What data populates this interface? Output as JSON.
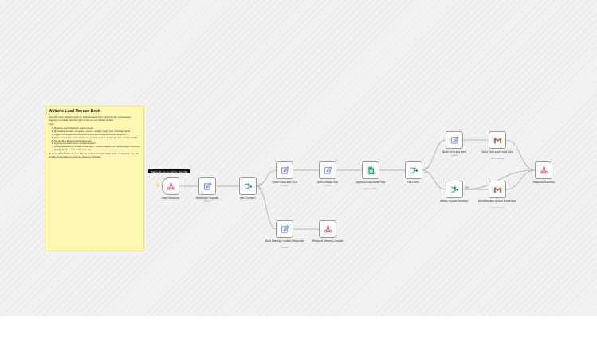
{
  "sticky_note": {
    "title": "Website Lead Rescue Desk",
    "intro": "Use this when website leads go stale because form payloads are inconsistent, urgency is unclear, and the right person is not notified quickly.",
    "flow_heading": "Flow",
    "steps": [
      "Receive a website/form lead payload.",
      "Normalize contact, company, source, budget, page, and message fields.",
      "Reject incomplete submissions with a structured webhook response.",
      "Score intent from pricing/demo/urgent/integration language plus contact quality.",
      "Set an SLA bucket and dedupe key.",
      "Append an audit row to Google Sheets.",
      "Route hot leads to a sales Gmail alert; medium leads to a review queue; and low-priority leads to a normal response."
    ],
    "footer": "Replace placeholder Google Sheets and Gmail credentials before production use. No private credentials or customer data are included."
  },
  "tooltip": "Waiting for you to call the Test URL",
  "nodes": [
    {
      "id": "lead-webhook",
      "label": "Lead Webhook",
      "sub": "",
      "icon": "webhook-icon",
      "color": "#ee4a7a",
      "trigger": true
    },
    {
      "id": "normalize-payload",
      "label": "Normalize Payload",
      "sub": "manual",
      "icon": "pencil-icon",
      "color": "#6a82e0"
    },
    {
      "id": "has-contact",
      "label": "Has Contact?",
      "sub": "",
      "icon": "if-branch-icon",
      "color": "#26948a"
    },
    {
      "id": "score-lead-sla",
      "label": "Score Lead and SLA",
      "sub": "manual",
      "icon": "pencil-icon",
      "color": "#6a82e0"
    },
    {
      "id": "build-unique-key",
      "label": "Build Unique Key",
      "sub": "manual",
      "icon": "pencil-icon",
      "color": "#6a82e0"
    },
    {
      "id": "append-audit-row",
      "label": "Append Lead Audit Row",
      "sub": "append: sheet",
      "icon": "google-sheets-icon",
      "color": "#1fa463"
    },
    {
      "id": "hot-lead",
      "label": "Hot Lead?",
      "sub": "",
      "icon": "if-branch-icon",
      "color": "#26948a"
    },
    {
      "id": "build-hot-alert",
      "label": "Build Hot Lead Alert",
      "sub": "manual",
      "icon": "pencil-icon",
      "color": "#6a82e0"
    },
    {
      "id": "send-hot-email",
      "label": "Send Hot Lead Email Alert",
      "sub": "send: message",
      "icon": "gmail-icon",
      "color": "#ea4335"
    },
    {
      "id": "needs-review",
      "label": "Needs Human Review?",
      "sub": "",
      "icon": "if-branch-icon",
      "color": "#26948a"
    },
    {
      "id": "send-review-email",
      "label": "Send Review Queue Email Alert",
      "sub": "send: message",
      "icon": "gmail-icon",
      "color": "#ea4335"
    },
    {
      "id": "respond-success",
      "label": "Respond Success",
      "sub": "",
      "icon": "webhook-icon",
      "color": "#ee4a7a"
    },
    {
      "id": "build-missing-contact",
      "label": "Build Missing Contact Response",
      "sub": "manual",
      "icon": "pencil-icon",
      "color": "#6a82e0"
    },
    {
      "id": "respond-missing-contact",
      "label": "Respond Missing Contact",
      "sub": "",
      "icon": "webhook-icon",
      "color": "#ee4a7a"
    }
  ],
  "edges": [
    {
      "from": "lead-webhook",
      "to": "normalize-payload"
    },
    {
      "from": "normalize-payload",
      "to": "has-contact"
    },
    {
      "from": "has-contact",
      "to": "score-lead-sla",
      "label": "true"
    },
    {
      "from": "has-contact",
      "to": "build-missing-contact",
      "label": "false"
    },
    {
      "from": "score-lead-sla",
      "to": "build-unique-key"
    },
    {
      "from": "build-unique-key",
      "to": "append-audit-row"
    },
    {
      "from": "append-audit-row",
      "to": "hot-lead"
    },
    {
      "from": "hot-lead",
      "to": "build-hot-alert",
      "label": "true"
    },
    {
      "from": "hot-lead",
      "to": "needs-review",
      "label": "false"
    },
    {
      "from": "build-hot-alert",
      "to": "send-hot-email"
    },
    {
      "from": "needs-review",
      "to": "send-review-email",
      "label": "true"
    },
    {
      "from": "needs-review",
      "to": "respond-success",
      "label": "false"
    },
    {
      "from": "send-hot-email",
      "to": "respond-success"
    },
    {
      "from": "send-review-email",
      "to": "respond-success"
    },
    {
      "from": "build-missing-contact",
      "to": "respond-missing-contact"
    }
  ]
}
